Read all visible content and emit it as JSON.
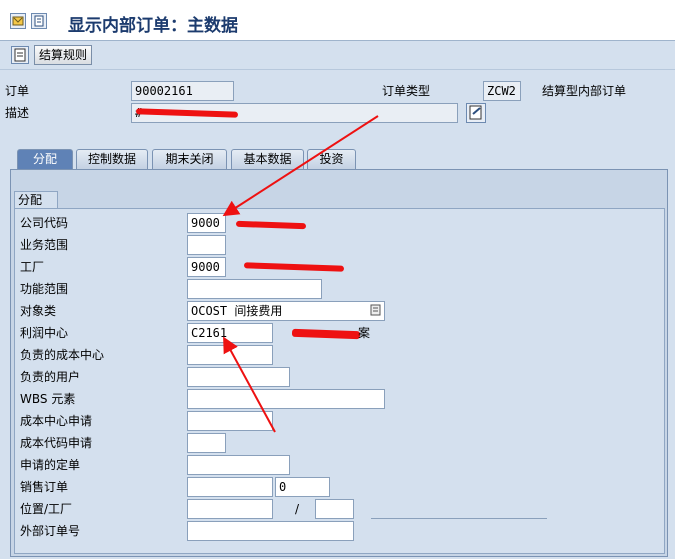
{
  "header": {
    "title": "显示内部订单：主数据"
  },
  "toolbar": {
    "settlement_rule": "结算规则"
  },
  "order": {
    "order_label": "订单",
    "order_value": "90002161",
    "order_type_label": "订单类型",
    "order_type_value": "ZCW2",
    "order_type_desc": "结算型内部订单",
    "description_label": "描述",
    "description_value": "#"
  },
  "tabs": [
    "分配",
    "控制数据",
    "期末关闭",
    "基本数据",
    "投资"
  ],
  "group": {
    "title": "分配",
    "fields": [
      {
        "label": "公司代码",
        "value": "9000",
        "desc": ""
      },
      {
        "label": "业务范围",
        "value": ""
      },
      {
        "label": "工厂",
        "value": "9000",
        "desc": ""
      },
      {
        "label": "功能范围",
        "value": ""
      },
      {
        "label": "对象类",
        "value": "OCOST 间接费用"
      },
      {
        "label": "利润中心",
        "value": "C2161",
        "desc": "案"
      },
      {
        "label": "负责的成本中心",
        "value": ""
      },
      {
        "label": "负责的用户",
        "value": ""
      },
      {
        "label": "WBS 元素",
        "value": ""
      },
      {
        "label": "成本中心申请",
        "value": ""
      },
      {
        "label": "成本代码申请",
        "value": ""
      },
      {
        "label": "申请的定单",
        "value": ""
      },
      {
        "label": "销售订单",
        "value": "",
        "value2": "0"
      },
      {
        "label": "位置/工厂",
        "value": "",
        "sep": "/"
      },
      {
        "label": "外部订单号",
        "value": ""
      }
    ]
  },
  "colors": {
    "accent": "#1c3b6e",
    "active_tab": "#5f82b6",
    "annotation": "#ee1111"
  },
  "icons": [
    "display-change-icon",
    "save-icon",
    "document-icon",
    "details-icon"
  ]
}
